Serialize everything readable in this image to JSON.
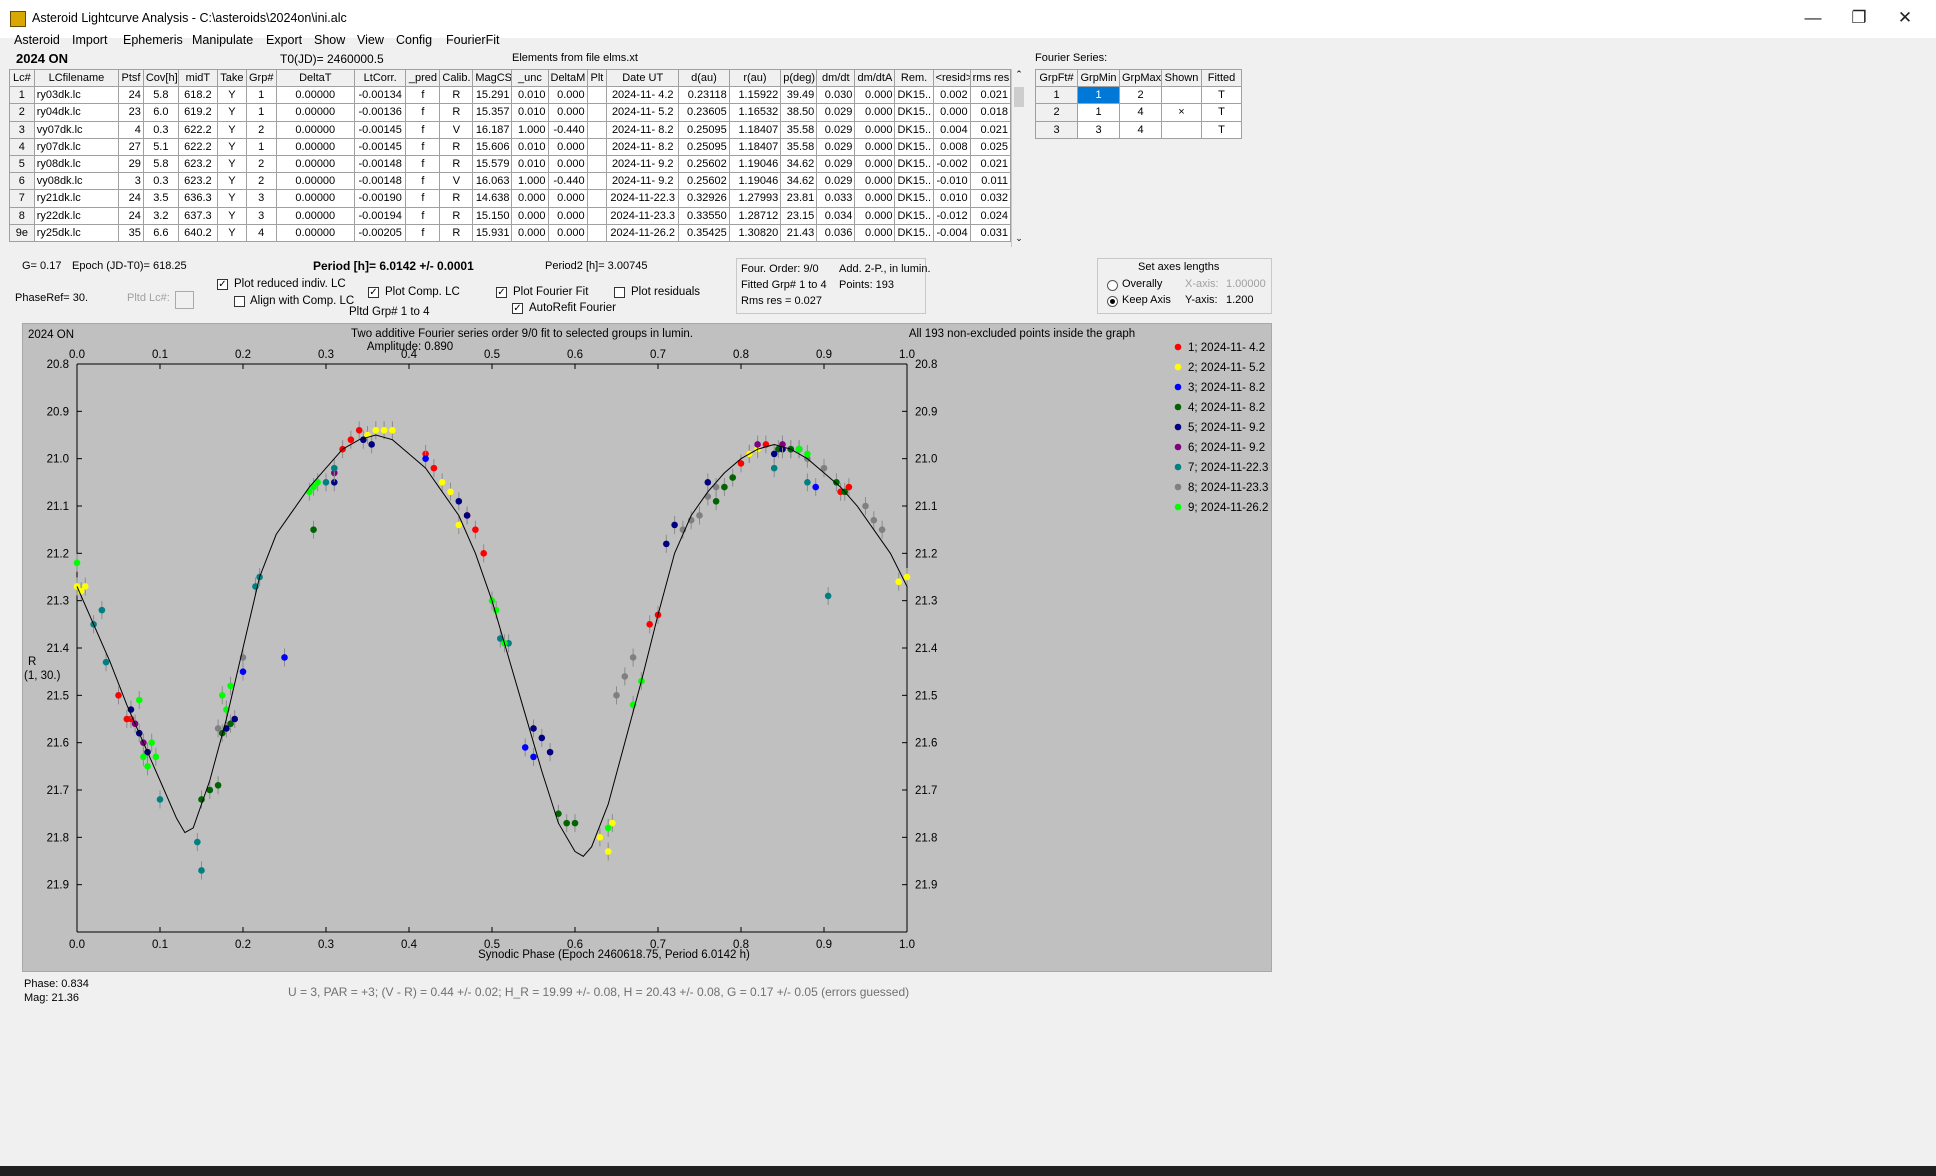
{
  "window": {
    "title": "Asteroid Lightcurve Analysis - C:\\asteroids\\2024on\\ini.alc",
    "minimize": "—",
    "restore": "❐",
    "close": "✕"
  },
  "menu": [
    "Asteroid",
    "Import",
    "Ephemeris",
    "Manipulate",
    "Export",
    "Show",
    "View",
    "Config",
    "FourierFit"
  ],
  "header": {
    "object": "2024 ON",
    "t0": "T0(JD)= 2460000.5",
    "elements": "Elements from file elms.xt"
  },
  "lc_table": {
    "columns": [
      "Lc#",
      "LCfilename",
      "Ptsf",
      "Cov[h]",
      "midT",
      "Take",
      "Grp#",
      "DeltaT",
      "LtCorr.",
      "_pred",
      "Calib.",
      "MagCS",
      "_unc",
      "DeltaM",
      "Plt",
      "Date UT",
      "d(au)",
      "r(au)",
      "p(deg)",
      "dm/dt",
      "dm/dtA",
      "Rem.",
      "<resid>",
      "rms res"
    ],
    "rows": [
      [
        "1",
        "ry03dk.lc",
        "24",
        "5.8",
        "618.2",
        "Y",
        "1",
        "0.00000",
        "-0.00134",
        "f",
        "R",
        "15.291",
        "0.010",
        "0.000",
        "",
        "2024-11- 4.2",
        "0.23118",
        "1.15922",
        "39.49",
        "0.030",
        "0.000",
        "DK15..",
        "0.002",
        "0.021"
      ],
      [
        "2",
        "ry04dk.lc",
        "23",
        "6.0",
        "619.2",
        "Y",
        "1",
        "0.00000",
        "-0.00136",
        "f",
        "R",
        "15.357",
        "0.010",
        "0.000",
        "",
        "2024-11- 5.2",
        "0.23605",
        "1.16532",
        "38.50",
        "0.029",
        "0.000",
        "DK15..",
        "0.000",
        "0.018"
      ],
      [
        "3",
        "vy07dk.lc",
        "4",
        "0.3",
        "622.2",
        "Y",
        "2",
        "0.00000",
        "-0.00145",
        "f",
        "V",
        "16.187",
        "1.000",
        "-0.440",
        "",
        "2024-11- 8.2",
        "0.25095",
        "1.18407",
        "35.58",
        "0.029",
        "0.000",
        "DK15..",
        "0.004",
        "0.021"
      ],
      [
        "4",
        "ry07dk.lc",
        "27",
        "5.1",
        "622.2",
        "Y",
        "1",
        "0.00000",
        "-0.00145",
        "f",
        "R",
        "15.606",
        "0.010",
        "0.000",
        "",
        "2024-11- 8.2",
        "0.25095",
        "1.18407",
        "35.58",
        "0.029",
        "0.000",
        "DK15..",
        "0.008",
        "0.025"
      ],
      [
        "5",
        "ry08dk.lc",
        "29",
        "5.8",
        "623.2",
        "Y",
        "2",
        "0.00000",
        "-0.00148",
        "f",
        "R",
        "15.579",
        "0.010",
        "0.000",
        "",
        "2024-11- 9.2",
        "0.25602",
        "1.19046",
        "34.62",
        "0.029",
        "0.000",
        "DK15..",
        "-0.002",
        "0.021"
      ],
      [
        "6",
        "vy08dk.lc",
        "3",
        "0.3",
        "623.2",
        "Y",
        "2",
        "0.00000",
        "-0.00148",
        "f",
        "V",
        "16.063",
        "1.000",
        "-0.440",
        "",
        "2024-11- 9.2",
        "0.25602",
        "1.19046",
        "34.62",
        "0.029",
        "0.000",
        "DK15..",
        "-0.010",
        "0.011"
      ],
      [
        "7",
        "ry21dk.lc",
        "24",
        "3.5",
        "636.3",
        "Y",
        "3",
        "0.00000",
        "-0.00190",
        "f",
        "R",
        "14.638",
        "0.000",
        "0.000",
        "",
        "2024-11-22.3",
        "0.32926",
        "1.27993",
        "23.81",
        "0.033",
        "0.000",
        "DK15..",
        "0.010",
        "0.032"
      ],
      [
        "8",
        "ry22dk.lc",
        "24",
        "3.2",
        "637.3",
        "Y",
        "3",
        "0.00000",
        "-0.00194",
        "f",
        "R",
        "15.150",
        "0.000",
        "0.000",
        "",
        "2024-11-23.3",
        "0.33550",
        "1.28712",
        "23.15",
        "0.034",
        "0.000",
        "DK15..",
        "-0.012",
        "0.024"
      ],
      [
        "9e",
        "ry25dk.lc",
        "35",
        "6.6",
        "640.2",
        "Y",
        "4",
        "0.00000",
        "-0.00205",
        "f",
        "R",
        "15.931",
        "0.000",
        "0.000",
        "",
        "2024-11-26.2",
        "0.35425",
        "1.30820",
        "21.43",
        "0.036",
        "0.000",
        "DK15..",
        "-0.004",
        "0.031"
      ]
    ]
  },
  "fourier_series": {
    "title": "Fourier Series:",
    "columns": [
      "GrpFt#",
      "GrpMin",
      "GrpMax",
      "Shown",
      "Fitted"
    ],
    "rows": [
      [
        "1",
        "1",
        "2",
        "",
        "T"
      ],
      [
        "2",
        "1",
        "4",
        "×",
        "T"
      ],
      [
        "3",
        "3",
        "4",
        "",
        "T"
      ]
    ]
  },
  "params": {
    "g": "G= 0.17",
    "epoch": "Epoch (JD-T0)= 618.25",
    "period": "Period [h]= 6.0142 +/- 0.0001",
    "period2": "Period2 [h]= 3.00745",
    "phaseref": "PhaseRef= 30.",
    "pltd_lc": "Pltd Lc#:"
  },
  "checkboxes": {
    "plot_reduced": {
      "label": "Plot reduced indiv. LC",
      "checked": true
    },
    "align_comp": {
      "label": "Align with Comp. LC",
      "checked": false
    },
    "plot_comp": {
      "label": "Plot Comp. LC",
      "checked": true
    },
    "plot_fourier": {
      "label": "Plot Fourier Fit",
      "checked": true
    },
    "autorefit": {
      "label": "AutoRefit Fourier",
      "checked": true
    },
    "plot_residuals": {
      "label": "Plot residuals",
      "checked": false
    }
  },
  "pltd_grp": "Pltd Grp#  1   to   4",
  "fit_info": {
    "order": "Four. Order:  9/0",
    "add": "Add. 2-P., in lumin.",
    "fitted": "Fitted Grp# 1 to 4",
    "points": "Points: 193",
    "rms": "Rms res     = 0.027"
  },
  "axes_box": {
    "title": "Set axes lengths",
    "overally": "Overally",
    "keep": "Keep Axis",
    "x_label": "X-axis:",
    "x_value": "1.00000",
    "y_label": "Y-axis:",
    "y_value": "1.200",
    "selected": "keep"
  },
  "plot": {
    "corner_title": "2024 ON",
    "header1": "Two additive Fourier series order 9/0 fit to selected groups in lumin.",
    "header2": "Amplitude: 0.890",
    "header_right": "All 193 non-excluded points inside the graph",
    "ylabel1": "R",
    "ylabel2": "(1, 30.)",
    "xlabel": "Synodic Phase (Epoch 2460618.75, Period 6.0142 h)"
  },
  "status": {
    "phase": "Phase:  0.834",
    "mag": "Mag:    21.36",
    "result": "U = 3, PAR = +3; (V - R) = 0.44 +/- 0.02; H_R = 19.99 +/- 0.08, H = 20.43 +/- 0.08, G = 0.17 +/- 0.05 (errors guessed)"
  },
  "chart_data": {
    "type": "scatter",
    "xlabel": "Synodic Phase (Epoch 2460618.75, Period 6.0142 h)",
    "ylabel": "R",
    "xlim": [
      0,
      1
    ],
    "ylim": [
      20.8,
      22.0
    ],
    "y_inverted": true,
    "x_ticks": [
      "0.0",
      "0.1",
      "0.2",
      "0.3",
      "0.4",
      "0.5",
      "0.6",
      "0.7",
      "0.8",
      "0.9",
      "1.0"
    ],
    "y_ticks": [
      "20.8",
      "20.9",
      "21.0",
      "21.1",
      "21.2",
      "21.3",
      "21.4",
      "21.5",
      "21.6",
      "21.7",
      "21.8",
      "21.9"
    ],
    "legend_position": "right",
    "series": [
      {
        "name": "1; 2024-11- 4.2",
        "color": "#ff0000",
        "x": [
          0.05,
          0.06,
          0.065,
          0.32,
          0.33,
          0.34,
          0.42,
          0.43,
          0.47,
          0.48,
          0.49,
          0.69,
          0.7,
          0.8,
          0.81,
          0.83,
          0.92,
          0.93
        ],
        "y": [
          21.5,
          21.55,
          21.55,
          20.98,
          20.96,
          20.94,
          20.99,
          21.02,
          21.12,
          21.15,
          21.2,
          21.35,
          21.33,
          21.01,
          20.99,
          20.97,
          21.07,
          21.06
        ]
      },
      {
        "name": "2; 2024-11- 5.2",
        "color": "#ffff00",
        "x": [
          0.0,
          0.005,
          0.01,
          0.35,
          0.36,
          0.37,
          0.38,
          0.44,
          0.45,
          0.46,
          0.63,
          0.64,
          0.645,
          0.81,
          0.82,
          0.99,
          1.0
        ],
        "y": [
          21.27,
          21.28,
          21.27,
          20.95,
          20.94,
          20.94,
          20.94,
          21.05,
          21.07,
          21.14,
          21.8,
          21.83,
          21.77,
          20.99,
          20.98,
          21.26,
          21.25
        ]
      },
      {
        "name": "3; 2024-11- 8.2",
        "color": "#0000ff",
        "x": [
          0.2,
          0.25,
          0.42,
          0.54,
          0.55,
          0.86,
          0.89
        ],
        "y": [
          21.45,
          21.42,
          21.0,
          21.61,
          21.63,
          20.98,
          21.06
        ]
      },
      {
        "name": "4; 2024-11- 8.2",
        "color": "#006400",
        "x": [
          0.15,
          0.16,
          0.17,
          0.175,
          0.185,
          0.285,
          0.58,
          0.59,
          0.6,
          0.77,
          0.78,
          0.79,
          0.845,
          0.86,
          0.915,
          0.925
        ],
        "y": [
          21.72,
          21.7,
          21.69,
          21.58,
          21.56,
          21.15,
          21.75,
          21.77,
          21.77,
          21.09,
          21.06,
          21.04,
          20.98,
          20.98,
          21.05,
          21.07
        ]
      },
      {
        "name": "5; 2024-11- 9.2",
        "color": "#000080",
        "x": [
          0.065,
          0.075,
          0.085,
          0.18,
          0.19,
          0.31,
          0.345,
          0.355,
          0.46,
          0.47,
          0.55,
          0.56,
          0.57,
          0.71,
          0.72,
          0.76,
          0.84,
          0.85,
          0.87
        ],
        "y": [
          21.53,
          21.58,
          21.62,
          21.57,
          21.55,
          21.05,
          20.96,
          20.97,
          21.09,
          21.12,
          21.57,
          21.59,
          21.62,
          21.18,
          21.14,
          21.05,
          20.99,
          20.98,
          20.98
        ]
      },
      {
        "name": "6; 2024-11- 9.2",
        "color": "#800080",
        "x": [
          0.07,
          0.08,
          0.31,
          0.82,
          0.85
        ],
        "y": [
          21.56,
          21.6,
          21.03,
          20.97,
          20.97
        ]
      },
      {
        "name": "7; 2024-11-22.3",
        "color": "#008080",
        "x": [
          0.02,
          0.03,
          0.035,
          0.1,
          0.145,
          0.15,
          0.215,
          0.22,
          0.3,
          0.31,
          0.51,
          0.52,
          0.84,
          0.88,
          0.905
        ],
        "y": [
          21.35,
          21.32,
          21.43,
          21.72,
          21.81,
          21.87,
          21.27,
          21.25,
          21.05,
          21.02,
          21.38,
          21.39,
          21.02,
          21.05,
          21.29
        ]
      },
      {
        "name": "8; 2024-11-23.3",
        "color": "#808080",
        "x": [
          0.17,
          0.2,
          0.65,
          0.66,
          0.67,
          0.73,
          0.74,
          0.75,
          0.76,
          0.77,
          0.88,
          0.9,
          0.95,
          0.96,
          0.97
        ],
        "y": [
          21.57,
          21.42,
          21.5,
          21.46,
          21.42,
          21.15,
          21.13,
          21.12,
          21.08,
          21.06,
          21.0,
          21.02,
          21.1,
          21.13,
          21.15
        ]
      },
      {
        "name": "9; 2024-11-26.2",
        "color": "#00ff00",
        "x": [
          0.0,
          0.075,
          0.08,
          0.085,
          0.09,
          0.095,
          0.175,
          0.18,
          0.185,
          0.28,
          0.285,
          0.29,
          0.5,
          0.505,
          0.515,
          0.64,
          0.67,
          0.68,
          0.87,
          0.88
        ],
        "y": [
          21.22,
          21.51,
          21.63,
          21.65,
          21.6,
          21.63,
          21.5,
          21.53,
          21.48,
          21.07,
          21.06,
          21.05,
          21.3,
          21.32,
          21.39,
          21.78,
          21.52,
          21.47,
          20.98,
          20.99
        ]
      },
      {
        "name": "Fourier fit",
        "color": "#000000",
        "x": [
          0.0,
          0.02,
          0.04,
          0.06,
          0.08,
          0.1,
          0.12,
          0.13,
          0.14,
          0.16,
          0.18,
          0.2,
          0.22,
          0.24,
          0.26,
          0.28,
          0.3,
          0.32,
          0.34,
          0.36,
          0.38,
          0.4,
          0.42,
          0.44,
          0.46,
          0.48,
          0.5,
          0.52,
          0.54,
          0.56,
          0.58,
          0.6,
          0.61,
          0.62,
          0.64,
          0.66,
          0.68,
          0.7,
          0.72,
          0.74,
          0.76,
          0.78,
          0.8,
          0.82,
          0.84,
          0.86,
          0.88,
          0.9,
          0.92,
          0.94,
          0.96,
          0.98,
          1.0
        ],
        "y": [
          21.27,
          21.35,
          21.43,
          21.52,
          21.6,
          21.68,
          21.76,
          21.79,
          21.78,
          21.68,
          21.55,
          21.4,
          21.25,
          21.16,
          21.11,
          21.06,
          21.02,
          20.98,
          20.96,
          20.95,
          20.96,
          20.99,
          21.02,
          21.07,
          21.12,
          21.2,
          21.3,
          21.42,
          21.54,
          21.66,
          21.77,
          21.83,
          21.84,
          21.82,
          21.73,
          21.6,
          21.47,
          21.33,
          21.2,
          21.12,
          21.07,
          21.03,
          21.0,
          20.98,
          20.97,
          20.98,
          21.0,
          21.03,
          21.06,
          21.1,
          21.15,
          21.2,
          21.27
        ]
      }
    ]
  }
}
